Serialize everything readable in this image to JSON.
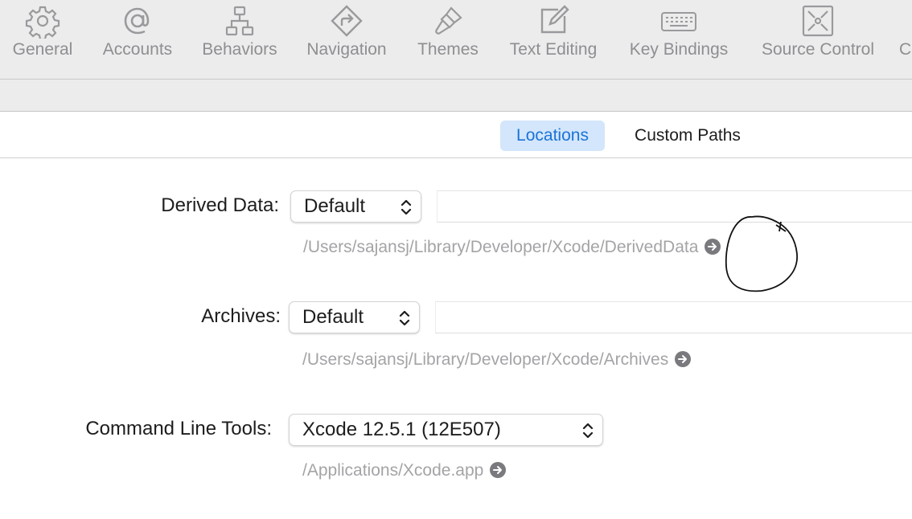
{
  "toolbar": {
    "items": [
      {
        "label": "General",
        "icon": "gear-icon"
      },
      {
        "label": "Accounts",
        "icon": "at-sign-icon"
      },
      {
        "label": "Behaviors",
        "icon": "network-icon"
      },
      {
        "label": "Navigation",
        "icon": "navigation-arrow-icon"
      },
      {
        "label": "Themes",
        "icon": "paintbrush-icon"
      },
      {
        "label": "Text Editing",
        "icon": "pencil-square-icon"
      },
      {
        "label": "Key Bindings",
        "icon": "keyboard-icon"
      },
      {
        "label": "Source Control",
        "icon": "source-control-icon"
      },
      {
        "label": "C",
        "icon": "partial-icon"
      }
    ]
  },
  "tabs": {
    "locations": "Locations",
    "custom_paths": "Custom Paths",
    "selected": "Locations"
  },
  "derived_data": {
    "label": "Derived Data:",
    "popup_value": "Default",
    "path": "/Users/sajansj/Library/Developer/Xcode/DerivedData"
  },
  "archives": {
    "label": "Archives:",
    "popup_value": "Default",
    "path": "/Users/sajansj/Library/Developer/Xcode/Archives"
  },
  "command_line_tools": {
    "label": "Command Line Tools:",
    "popup_value": "Xcode 12.5.1 (12E507)",
    "path": "/Applications/Xcode.app"
  },
  "colors": {
    "accent": "#1a73d9",
    "selected_tab_bg": "#d3e6fb",
    "toolbar_bg": "#ececec",
    "path_text": "#a4a4a8"
  }
}
